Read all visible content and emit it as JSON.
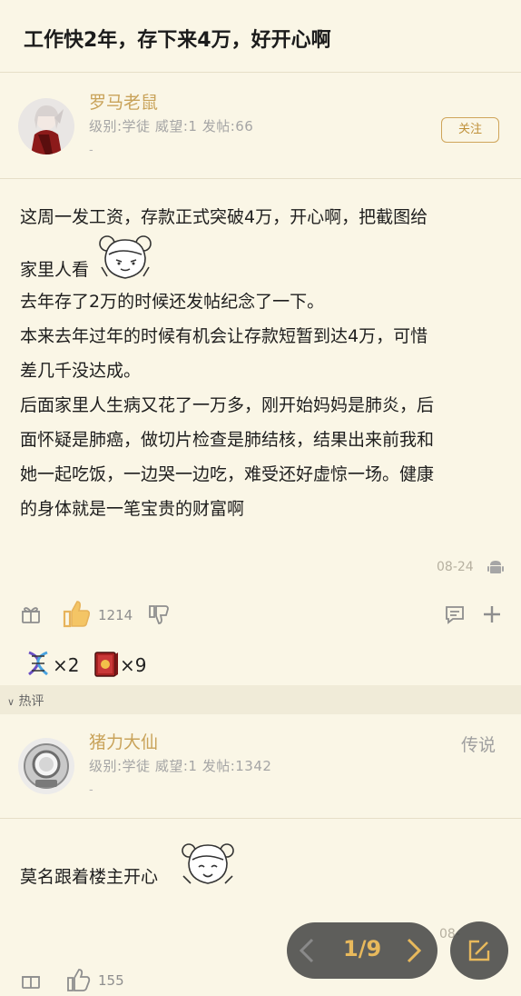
{
  "post": {
    "title": "工作快2年，存下来4万，好开心啊"
  },
  "author": {
    "name": "罗马老鼠",
    "meta": "级别:学徒 威望:1 发帖:66",
    "dash": "-",
    "follow_label": "关注"
  },
  "content": {
    "lines": [
      "这周一发工资，存款正式突破4万，开心啊，把截图给",
      "家里人看",
      "去年存了2万的时候还发帖纪念了一下。",
      "本来去年过年的时候有机会让存款短暂到达4万，可惜",
      "差几千没达成。",
      "后面家里人生病又花了一万多，刚开始妈妈是肺炎，后",
      "面怀疑是肺癌，做切片检查是肺结核，结果出来前我和",
      "她一起吃饭，一边哭一边吃，难受还好虚惊一场。健康",
      "的身体就是一笔宝贵的财富啊"
    ],
    "date": "08-24"
  },
  "actions": {
    "like_count": "1214",
    "gift1_count": "×2",
    "gift2_count": "×9"
  },
  "hot_section": {
    "label": "热评"
  },
  "reply": {
    "name": "猪力大仙",
    "rank": "传说",
    "meta": "级别:学徒 威望:1 发帖:1342",
    "dash": "-",
    "text": "莫名跟着楼主开心",
    "like_count_partial": "155",
    "date_partial": "08-"
  },
  "pager": {
    "label": "1/9"
  },
  "colors": {
    "background": "#faf6e6",
    "accent_gold": "#c9a35a",
    "pager_text": "#e8b95c"
  }
}
